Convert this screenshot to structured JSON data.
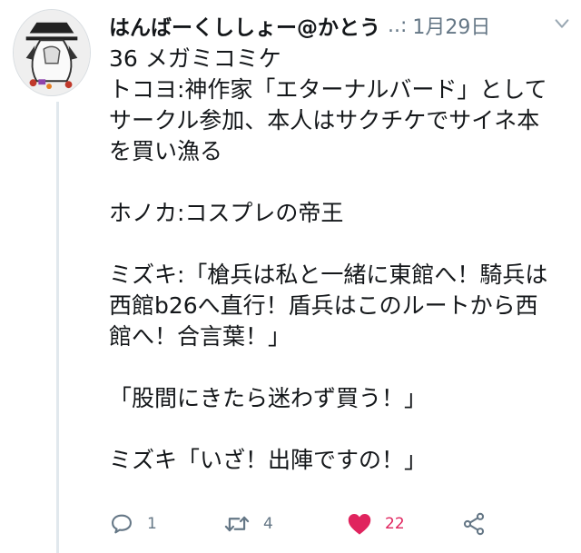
{
  "tweet": {
    "author_name": "はんばーくししょー@かとう",
    "more_indicator": "..:",
    "date": "1月29日",
    "lines": [
      "36 メガミコミケ",
      "トコヨ:神作家「エターナルバード」として",
      "サークル参加、本人はサクチケでサイネ本",
      "を買い漁る",
      "",
      "ホノカ:コスプレの帝王",
      "",
      "ミズキ:「槍兵は私と一緒に東館へ！騎兵は",
      "西館b26へ直行！盾兵はこのルートから西",
      "館へ！合言葉！」",
      "",
      "「股間にきたら迷わず買う！」",
      "",
      "ミズキ「いざ！出陣ですの！」"
    ]
  },
  "actions": {
    "reply_count": "1",
    "retweet_count": "4",
    "like_count": "22"
  },
  "icons": {
    "reply": "reply-icon",
    "retweet": "retweet-icon",
    "like": "heart-icon",
    "share": "share-icon",
    "menu": "chevron-down-icon"
  },
  "colors": {
    "text": "#14171a",
    "secondary": "#657786",
    "like": "#e0245e",
    "thread_line": "#e1e8ed"
  }
}
